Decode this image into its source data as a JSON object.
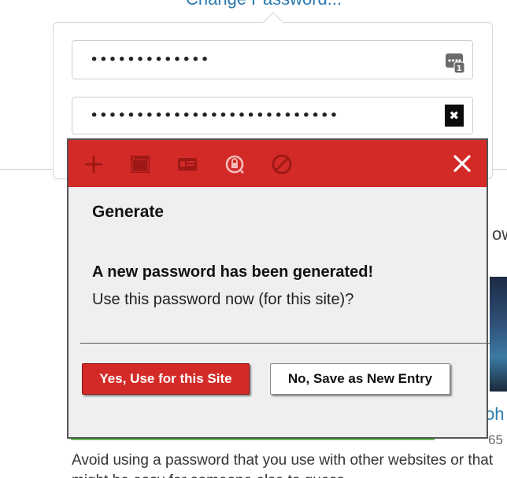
{
  "page": {
    "top_link": "Change Password...",
    "side_partial_1": "ow",
    "side_partial_2": "oh",
    "side_partial_3": "65",
    "paragraph": "Avoid using a password that you use with other websites or that might be easy for someone else to guess."
  },
  "fields": {
    "current_password_value": "•••••••••••••",
    "new_password_value": "•••••••••••••••••••••••••••",
    "clear_glyph": "✖"
  },
  "icons": {
    "keepass_field": "keepass-field-icon",
    "clear": "clear-field-icon",
    "toolbar": [
      "add-icon",
      "window-icon",
      "card-icon",
      "password-generator-icon",
      "disable-icon"
    ],
    "close": "close-icon"
  },
  "dialog": {
    "title": "Generate",
    "message_heading": "A new password has been generated!",
    "message_body": "Use this password now (for this site)?",
    "yes_label": "Yes, Use for this Site",
    "no_label": "No, Save as New Entry"
  },
  "colors": {
    "accent_red": "#d42a27",
    "link_blue": "#2a7ab0",
    "dialog_bg": "#efefef"
  }
}
